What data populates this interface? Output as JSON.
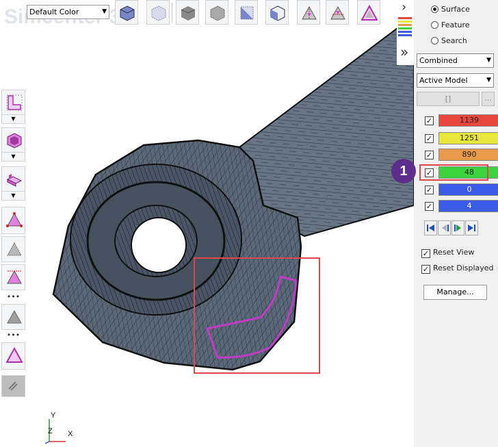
{
  "app": {
    "watermark": "Simcenter 3"
  },
  "toolbar": {
    "color_mode": "Default Color",
    "buttons": [
      "cube-shaded-icon",
      "cube-wireframe-icon",
      "cube-solid-icon",
      "cube-hidden-icon",
      "cube-edges-icon",
      "cube-outline-icon",
      "triangle-split-icon",
      "triangle-cut-icon",
      "triangle-shape-icon"
    ]
  },
  "left_toolbar": {
    "buttons": [
      "l-shape-icon",
      "cube-select-icon",
      "block-icon",
      "triangle-node-icon",
      "triangle-grey-icon",
      "triangle-vertex-icon",
      "triangle-plain-icon",
      "triangle-magenta-icon",
      "link-icon"
    ]
  },
  "panel": {
    "selection_radios": [
      {
        "label": "Surface",
        "selected": true
      },
      {
        "label": "Feature",
        "selected": false
      },
      {
        "label": "Search",
        "selected": false
      }
    ],
    "combined_select": "Combined",
    "model_select": "Active Model",
    "bracket_button": "[]",
    "dots_button": "...",
    "layers": [
      {
        "value": "1139",
        "checked": true,
        "color": "#e8453c"
      },
      {
        "value": "1251",
        "checked": true,
        "color": "#e8e83c"
      },
      {
        "value": "890",
        "checked": true,
        "color": "#e89a4a"
      },
      {
        "value": "48",
        "checked": true,
        "color": "#3cd43c"
      },
      {
        "value": "0",
        "checked": true,
        "color": "#3c5be8"
      },
      {
        "value": "4",
        "checked": true,
        "color": "#3c5be8"
      }
    ],
    "reset_view": "Reset View",
    "reset_displayed": "Reset Displayed",
    "manage": "Manage..."
  },
  "callout": {
    "number": "1"
  },
  "axes": {
    "y": "Y",
    "z": "Z",
    "x": "X"
  }
}
